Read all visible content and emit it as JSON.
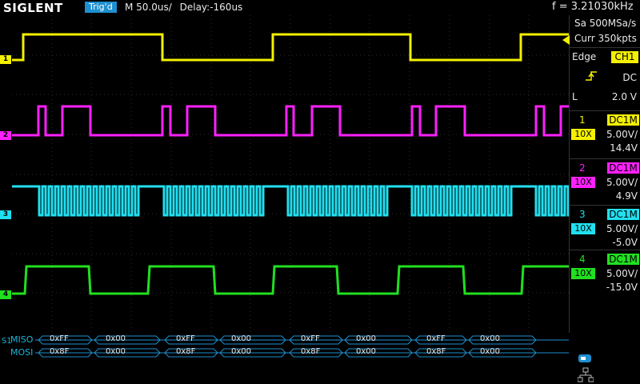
{
  "header": {
    "brand": "SIGLENT",
    "trigger_status": "Trig'd",
    "timebase": "M 50.0us/",
    "delay": "Delay:-160us",
    "frequency": "f = 3.21030kHz"
  },
  "acquisition": {
    "sample_rate": "Sa 500MSa/s",
    "memory": "Curr 350kpts"
  },
  "trigger": {
    "type": "Edge",
    "source": "CH1",
    "coupling": "DC",
    "level_mode": "L",
    "level": "2.0 V"
  },
  "channels": [
    {
      "num": "1",
      "coupling": "DC1M",
      "probe": "10X",
      "scale": "5.00V/",
      "offset": "14.4V",
      "color": "#f4f000"
    },
    {
      "num": "2",
      "coupling": "DC1M",
      "probe": "10X",
      "scale": "5.00V/",
      "offset": "4.9V",
      "color": "#ff20ff"
    },
    {
      "num": "3",
      "coupling": "DC1M",
      "probe": "10X",
      "scale": "5.00V/",
      "offset": "-5.0V",
      "color": "#20e0f0"
    },
    {
      "num": "4",
      "coupling": "DC1M",
      "probe": "10X",
      "scale": "5.00V/",
      "offset": "-15.0V",
      "color": "#20e020"
    }
  ],
  "decode": {
    "bus_marker": "S1",
    "miso_label": "MISO",
    "mosi_label": "MOSI",
    "miso_bytes": [
      "0xFF",
      "0x00",
      "0xFF",
      "0x00",
      "0xFF",
      "0x00",
      "0xFF",
      "0x00"
    ],
    "mosi_bytes": [
      "0x8F",
      "0x00",
      "0x8F",
      "0x00",
      "0x8F",
      "0x00",
      "0x8F",
      "0x00"
    ]
  },
  "icons": {
    "usb": "usb-icon",
    "network": "network-icon"
  }
}
